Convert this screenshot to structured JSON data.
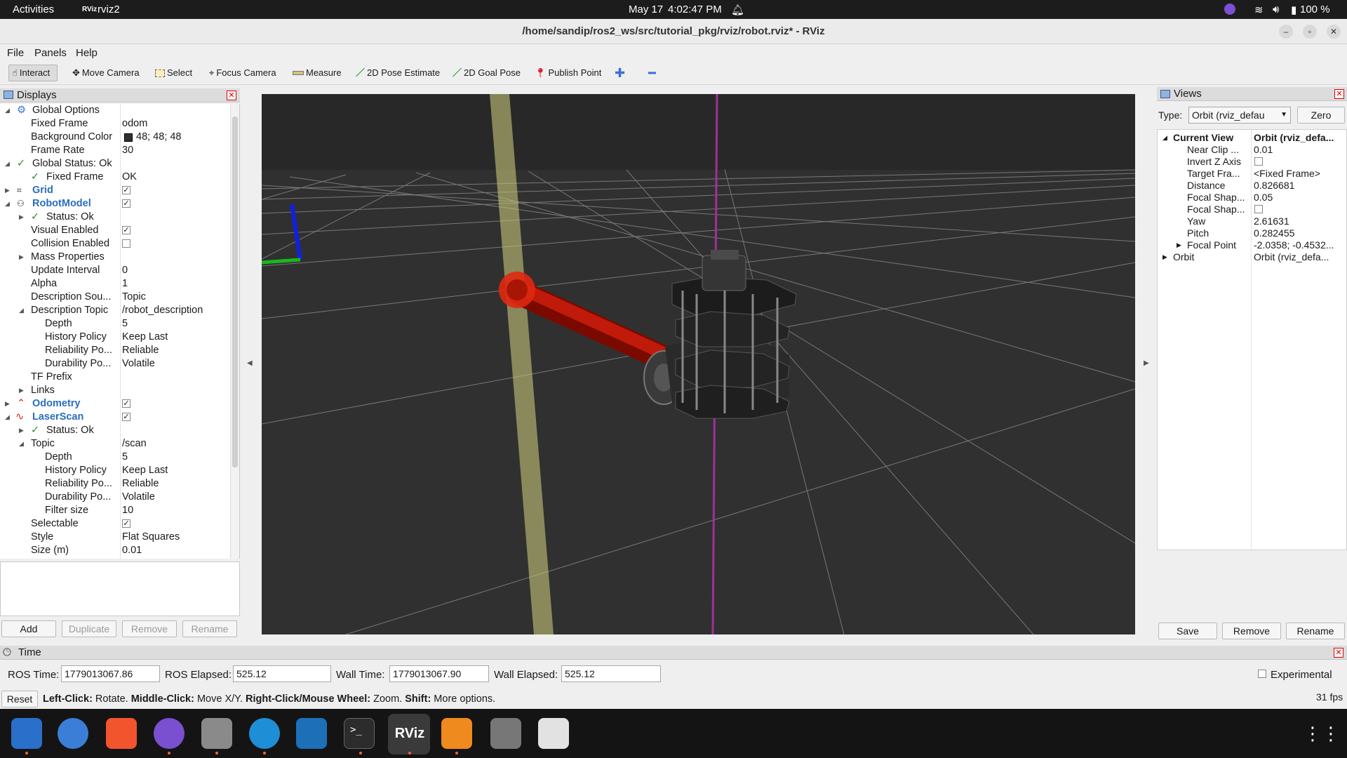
{
  "topbar": {
    "activities": "Activities",
    "app": "rviz2",
    "app_icon": "RViz",
    "date": "May 17",
    "time": "4:02:47 PM",
    "battery": "100 %"
  },
  "window": {
    "title": "/home/sandip/ros2_ws/src/tutorial_pkg/rviz/robot.rviz* - RViz"
  },
  "menu": {
    "file": "File",
    "panels": "Panels",
    "help": "Help"
  },
  "toolbar": {
    "interact": "Interact",
    "move_camera": "Move Camera",
    "select": "Select",
    "focus_camera": "Focus Camera",
    "measure": "Measure",
    "pose_estimate": "2D Pose Estimate",
    "goal_pose": "2D Goal Pose",
    "publish_point": "Publish Point"
  },
  "displays": {
    "title": "Displays",
    "rows": [
      {
        "name": "Global Options",
        "value": ""
      },
      {
        "name": "Fixed Frame",
        "value": "odom"
      },
      {
        "name": "Background Color",
        "value": "48; 48; 48"
      },
      {
        "name": "Frame Rate",
        "value": "30"
      },
      {
        "name": "Global Status: Ok",
        "value": ""
      },
      {
        "name": "Fixed Frame",
        "value": "OK"
      },
      {
        "name": "Grid",
        "value": ""
      },
      {
        "name": "RobotModel",
        "value": ""
      },
      {
        "name": "Status: Ok",
        "value": ""
      },
      {
        "name": "Visual Enabled",
        "value": ""
      },
      {
        "name": "Collision Enabled",
        "value": ""
      },
      {
        "name": "Mass Properties",
        "value": ""
      },
      {
        "name": "Update Interval",
        "value": "0"
      },
      {
        "name": "Alpha",
        "value": "1"
      },
      {
        "name": "Description Sou...",
        "value": "Topic"
      },
      {
        "name": "Description Topic",
        "value": "/robot_description"
      },
      {
        "name": "Depth",
        "value": "5"
      },
      {
        "name": "History Policy",
        "value": "Keep Last"
      },
      {
        "name": "Reliability Po...",
        "value": "Reliable"
      },
      {
        "name": "Durability Po...",
        "value": "Volatile"
      },
      {
        "name": "TF Prefix",
        "value": ""
      },
      {
        "name": "Links",
        "value": ""
      },
      {
        "name": "Odometry",
        "value": ""
      },
      {
        "name": "LaserScan",
        "value": ""
      },
      {
        "name": "Status: Ok",
        "value": ""
      },
      {
        "name": "Topic",
        "value": "/scan"
      },
      {
        "name": "Depth",
        "value": "5"
      },
      {
        "name": "History Policy",
        "value": "Keep Last"
      },
      {
        "name": "Reliability Po...",
        "value": "Reliable"
      },
      {
        "name": "Durability Po...",
        "value": "Volatile"
      },
      {
        "name": "Filter size",
        "value": "10"
      },
      {
        "name": "Selectable",
        "value": ""
      },
      {
        "name": "Style",
        "value": "Flat Squares"
      },
      {
        "name": "Size (m)",
        "value": "0.01"
      }
    ],
    "buttons": {
      "add": "Add",
      "duplicate": "Duplicate",
      "remove": "Remove",
      "rename": "Rename"
    }
  },
  "views": {
    "title": "Views",
    "type_label": "Type:",
    "type_value": "Orbit (rviz_defau",
    "zero": "Zero",
    "rows": [
      {
        "name": "Current View",
        "value": "Orbit (rviz_defa..."
      },
      {
        "name": "Near Clip ...",
        "value": "0.01"
      },
      {
        "name": "Invert Z Axis",
        "value": ""
      },
      {
        "name": "Target Fra...",
        "value": "<Fixed Frame>"
      },
      {
        "name": "Distance",
        "value": "0.826681"
      },
      {
        "name": "Focal Shap...",
        "value": "0.05"
      },
      {
        "name": "Focal Shap...",
        "value": ""
      },
      {
        "name": "Yaw",
        "value": "2.61631"
      },
      {
        "name": "Pitch",
        "value": "0.282455"
      },
      {
        "name": "Focal Point",
        "value": "-2.0358; -0.4532..."
      },
      {
        "name": "Orbit",
        "value": "Orbit (rviz_defa..."
      }
    ],
    "buttons": {
      "save": "Save",
      "remove": "Remove",
      "rename": "Rename"
    }
  },
  "time": {
    "title": "Time",
    "ros_time_label": "ROS Time:",
    "ros_time": "1779013067.86",
    "ros_elapsed_label": "ROS Elapsed:",
    "ros_elapsed": "525.12",
    "wall_time_label": "Wall Time:",
    "wall_time": "1779013067.90",
    "wall_elapsed_label": "Wall Elapsed:",
    "wall_elapsed": "525.12",
    "experimental": "Experimental"
  },
  "status": {
    "reset": "Reset",
    "hint_l_bold": "Left-Click:",
    "hint_l": " Rotate. ",
    "hint_m_bold": "Middle-Click:",
    "hint_m": " Move X/Y. ",
    "hint_r_bold": "Right-Click/Mouse Wheel:",
    "hint_r": " Zoom. ",
    "hint_s_bold": "Shift:",
    "hint_s": " More options.",
    "fps": "31 fps"
  },
  "dock": {
    "rviz_label": "RViz"
  }
}
